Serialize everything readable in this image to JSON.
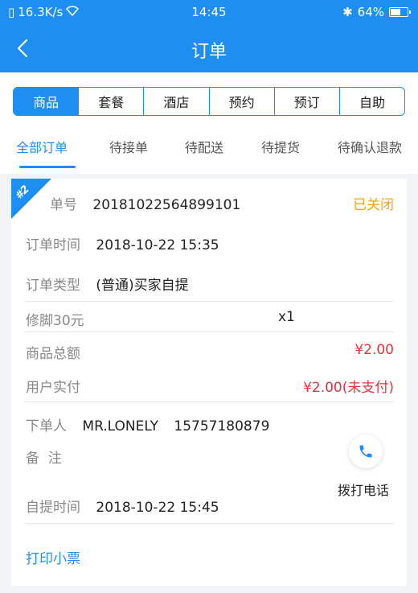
{
  "status_bar": {
    "speed": "16.3K/s",
    "time": "14:45",
    "battery_percent": "64%",
    "battery_level": 0.64
  },
  "nav": {
    "title": "订单"
  },
  "segments": [
    "商品",
    "套餐",
    "酒店",
    "预约",
    "预订",
    "自助"
  ],
  "tabs": [
    "全部订单",
    "待接单",
    "待配送",
    "待提货",
    "待确认退款"
  ],
  "order": {
    "badge": "#2",
    "number_label": "单号",
    "number": "20181022564899101",
    "status": "已关闭",
    "time_label": "订单时间",
    "time": "2018-10-22 15:35",
    "type_label": "订单类型",
    "type": "(普通)买家自提",
    "item_name": "修脚30元",
    "item_qty": "x1",
    "total_label": "商品总额",
    "total": "¥2.00",
    "paid_label": "用户实付",
    "paid": "¥2.00(未支付)",
    "buyer_label": "下单人",
    "buyer_name": "MR.LONELY",
    "buyer_phone": "15757180879",
    "remark_label": "备  注",
    "call_label": "拨打电话",
    "pickup_label": "自提时间",
    "pickup_time": "2018-10-22 15:45",
    "print_label": "打印小票"
  },
  "colors": {
    "primary": "#1e8ff0",
    "closed": "#f4a41c",
    "price": "#e8323c"
  }
}
